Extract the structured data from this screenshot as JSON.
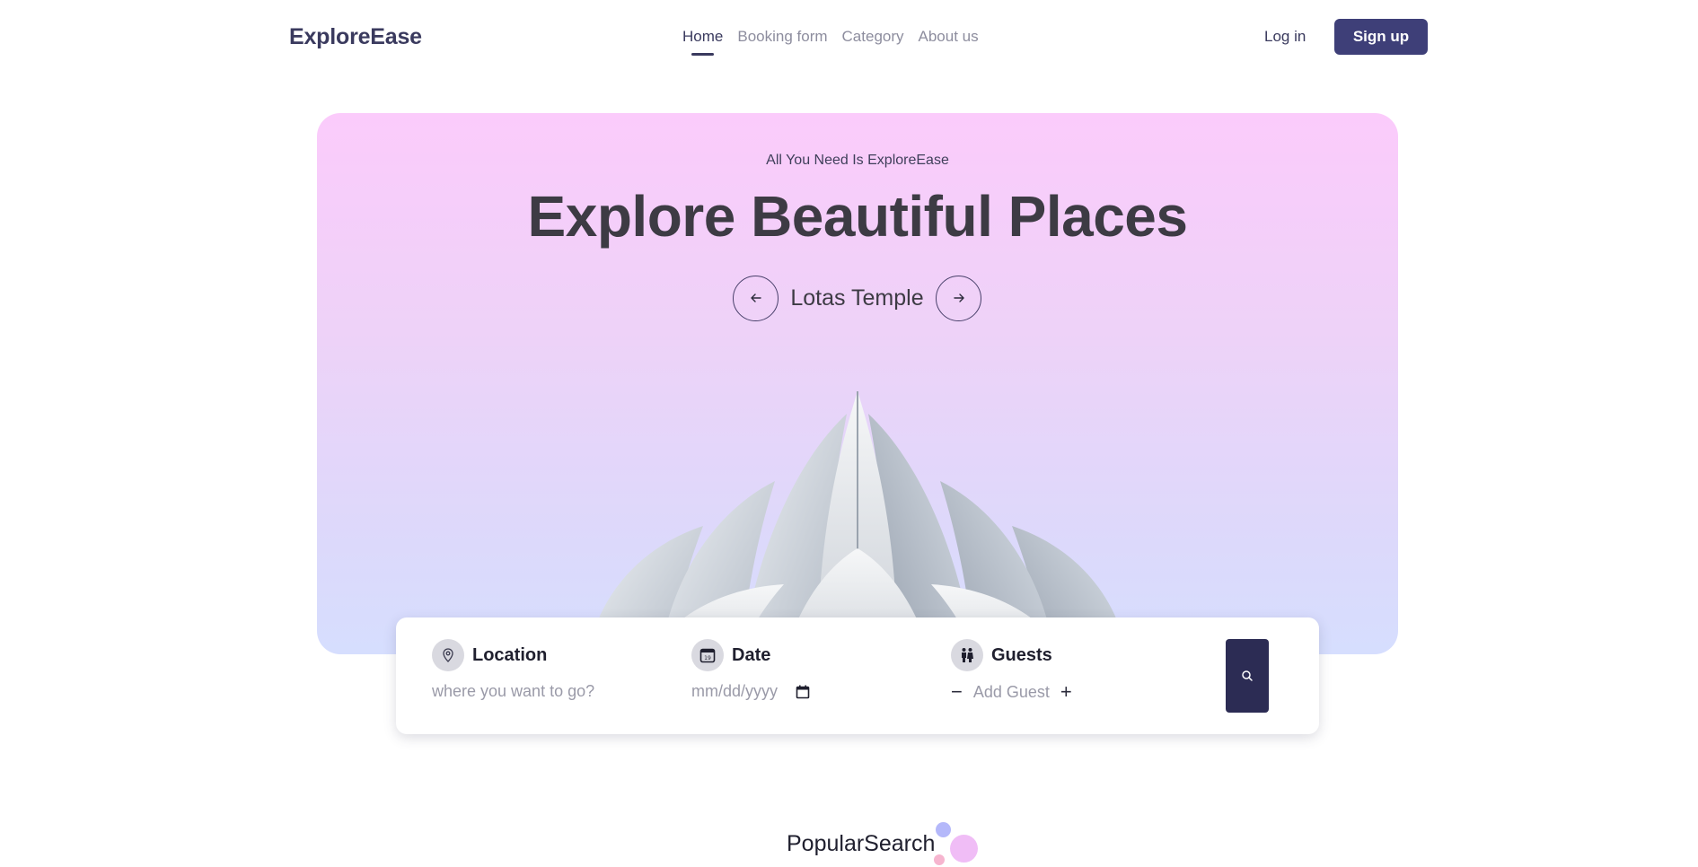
{
  "nav": {
    "logo": "ExploreEase",
    "items": [
      {
        "label": "Home",
        "active": true
      },
      {
        "label": "Booking form",
        "active": false
      },
      {
        "label": "Category",
        "active": false
      },
      {
        "label": "About us",
        "active": false
      }
    ],
    "login_label": "Log in",
    "signup_label": "Sign up"
  },
  "hero": {
    "tagline": "All You Need Is ExploreEase",
    "headline": "Explore Beautiful Places",
    "slide_name": "Lotas Temple",
    "prev_icon": "arrow-left-icon",
    "next_icon": "arrow-right-icon"
  },
  "search": {
    "location": {
      "title": "Location",
      "placeholder": "where you want to go?",
      "icon": "map-pin-icon"
    },
    "date": {
      "title": "Date",
      "value": "mm/dd/yyyy",
      "icon": "calendar-icon"
    },
    "guests": {
      "title": "Guests",
      "value": "Add Guest",
      "minus": "−",
      "plus": "+",
      "icon": "people-icon"
    },
    "button_icon": "search-icon"
  },
  "popular": {
    "title": "PopularSearch"
  },
  "colors": {
    "brand": "#3e3f78",
    "dark_button": "#2c2c54",
    "hero_top": "#fbcbfb",
    "hero_bottom": "#d6defe"
  }
}
